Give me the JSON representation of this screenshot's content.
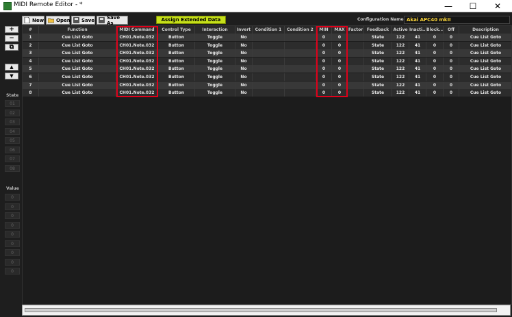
{
  "window": {
    "title": "MIDI Remote Editor - *",
    "minimize": "—",
    "maximize": "☐",
    "close": "✕"
  },
  "toolbar": {
    "new_label": "New",
    "open_label": "Open",
    "save_label": "Save",
    "save_as_label": "Save As",
    "assign_label": "Assign Extended Data",
    "config_label": "Configuration Name :",
    "config_value": "Akai APC40 mkII"
  },
  "sidebar": {
    "add": "+",
    "remove": "−",
    "copy": "⧉",
    "up": "▲",
    "down": "▼",
    "state_label": "State",
    "states": [
      "01",
      "02",
      "03",
      "04",
      "05",
      "06",
      "07",
      "08"
    ],
    "value_label": "Value",
    "values": [
      "0",
      "0",
      "0",
      "0",
      "0",
      "0",
      "0",
      "0",
      "0"
    ]
  },
  "table": {
    "headers": [
      "#",
      "Function",
      "MIDI Command",
      "Control Type",
      "Interaction",
      "Invert",
      "Condition 1",
      "Condition 2",
      "MIN",
      "MAX",
      "Factor",
      "Feedback",
      "Active",
      "Inacti...",
      "Block...",
      "Off",
      "Description"
    ],
    "rows": [
      [
        "1",
        "Cue List Goto",
        "CH01.Note.032",
        "Button",
        "Toggle",
        "No",
        "",
        "",
        "0",
        "0",
        "",
        "State",
        "122",
        "41",
        "0",
        "0",
        "Cue List Goto"
      ],
      [
        "2",
        "Cue List Goto",
        "CH01.Note.032",
        "Button",
        "Toggle",
        "No",
        "",
        "",
        "0",
        "0",
        "",
        "State",
        "122",
        "41",
        "0",
        "0",
        "Cue List Goto"
      ],
      [
        "3",
        "Cue List Goto",
        "CH01.Note.032",
        "Button",
        "Toggle",
        "No",
        "",
        "",
        "0",
        "0",
        "",
        "State",
        "122",
        "41",
        "0",
        "0",
        "Cue List Goto"
      ],
      [
        "4",
        "Cue List Goto",
        "CH01.Note.032",
        "Button",
        "Toggle",
        "No",
        "",
        "",
        "0",
        "0",
        "",
        "State",
        "122",
        "41",
        "0",
        "0",
        "Cue List Goto"
      ],
      [
        "5",
        "Cue List Goto",
        "CH01.Note.032",
        "Button",
        "Toggle",
        "No",
        "",
        "",
        "0",
        "0",
        "",
        "State",
        "122",
        "41",
        "0",
        "0",
        "Cue List Goto"
      ],
      [
        "6",
        "Cue List Goto",
        "CH01.Note.032",
        "Button",
        "Toggle",
        "No",
        "",
        "",
        "0",
        "0",
        "",
        "State",
        "122",
        "41",
        "0",
        "0",
        "Cue List Goto"
      ],
      [
        "7",
        "Cue List Goto",
        "CH01.Note.032",
        "Button",
        "Toggle",
        "No",
        "",
        "",
        "0",
        "0",
        "",
        "State",
        "122",
        "41",
        "0",
        "0",
        "Cue List Goto"
      ],
      [
        "8",
        "Cue List Goto",
        "CH01.Note.032",
        "Button",
        "Toggle",
        "No",
        "",
        "",
        "0",
        "0",
        "",
        "State",
        "122",
        "41",
        "0",
        "0",
        "Cue List Goto"
      ]
    ]
  },
  "colors": {
    "accent": "#c6e01a",
    "highlight": "#e0001a",
    "config_text": "#ffd83a"
  }
}
